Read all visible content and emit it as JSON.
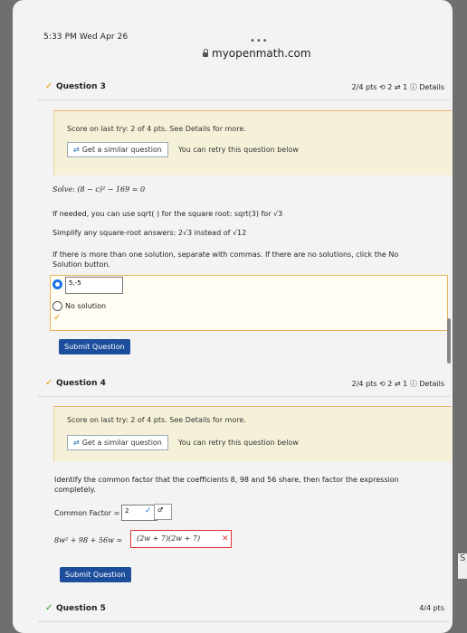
{
  "statusbar": {
    "time": "5:33 PM  Wed Apr 26",
    "dots": "•••",
    "url": "myopenmath.com"
  },
  "q3": {
    "title": "Question 3",
    "meta": "2/4 pts  ⟲ 2  ⇄ 1  ⓘ Details",
    "score": "Score on last try: 2 of 4 pts. See Details for more.",
    "similar": "Get a similar question",
    "retry": "You can retry this question below",
    "solve": "Solve: (8 − c)² − 169 = 0",
    "hint1": "If needed, you can use sqrt( ) for the square root: sqrt(3) for √3",
    "hint2": "Simplify any square-root answers: 2√3 instead of √12",
    "hint3a": "If there is more than one solution, separate with commas. If there are no solutions, click the No",
    "hint3b": "Solution button.",
    "answer": "5,-5",
    "no_solution": "No solution",
    "submit": "Submit Question"
  },
  "q4": {
    "title": "Question 4",
    "meta": "2/4 pts  ⟲ 2  ⇄ 1  ⓘ Details",
    "score": "Score on last try: 2 of 4 pts. See Details for more.",
    "similar": "Get a similar question",
    "retry": "You can retry this question below",
    "prompt_a": "Identify the common factor that the coefficients 8, 98 and 56 share, then factor the expression",
    "prompt_b": "completely.",
    "common_label": "Common Factor =",
    "common_value": "2",
    "expr_left": "8w² + 98 + 56w =",
    "expr_answer": "(2w + 7)(2w + 7)",
    "submit": "Submit Question"
  },
  "q5": {
    "title": "Question 5",
    "meta": "4/4 pts"
  },
  "side": {
    "label": "S"
  }
}
